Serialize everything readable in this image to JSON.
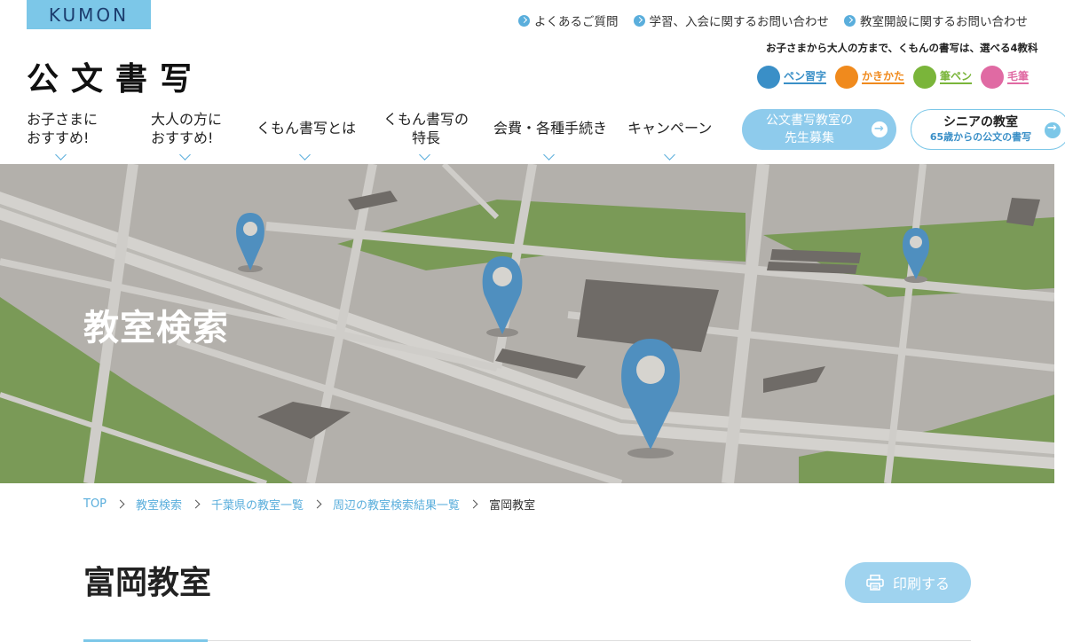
{
  "header": {
    "brand_logo": "KUMON",
    "site_title": "公文書写",
    "top_links": [
      {
        "label": "よくあるご質問"
      },
      {
        "label": "学習、入会に関するお問い合わせ"
      },
      {
        "label": "教室開設に関するお問い合わせ"
      }
    ],
    "subjects_tagline": "お子さまから大人の方まで、くもんの書写は、選べる4教科",
    "subjects": [
      {
        "label": "ペン習字",
        "color": "#3a8fc7"
      },
      {
        "label": "かきかた",
        "color": "#f08a1d"
      },
      {
        "label": "筆ペン",
        "color": "#7ab53a"
      },
      {
        "label": "毛筆",
        "color": "#e06aa3"
      }
    ]
  },
  "nav": {
    "items": [
      {
        "line1": "お子さまに",
        "line2": "おすすめ!"
      },
      {
        "line1": "大人の方に",
        "line2": "おすすめ!"
      },
      {
        "line1": "くもん書写とは",
        "line2": ""
      },
      {
        "line1": "くもん書写の",
        "line2": "特長"
      },
      {
        "line1": "会費・各種手続き",
        "line2": ""
      },
      {
        "line1": "キャンペーン",
        "line2": ""
      }
    ],
    "recruit_button": {
      "line1": "公文書写教室の",
      "line2": "先生募集"
    },
    "senior_button": {
      "line1": "シニアの教室",
      "line2": "65歳からの公文の書写"
    }
  },
  "hero": {
    "title": "教室検索"
  },
  "breadcrumb": [
    {
      "label": "TOP",
      "link": true
    },
    {
      "label": "教室検索",
      "link": true
    },
    {
      "label": "千葉県の教室一覧",
      "link": true
    },
    {
      "label": "周辺の教室検索結果一覧",
      "link": true
    },
    {
      "label": "富岡教室",
      "link": false
    }
  ],
  "main": {
    "page_title": "富岡教室",
    "print_label": "印刷する"
  },
  "colors": {
    "accent": "#7cc7e8",
    "link": "#5aaedc",
    "pin": "#4f8fbf",
    "map_green": "#7a9a57",
    "map_road": "#d3d1cd"
  }
}
